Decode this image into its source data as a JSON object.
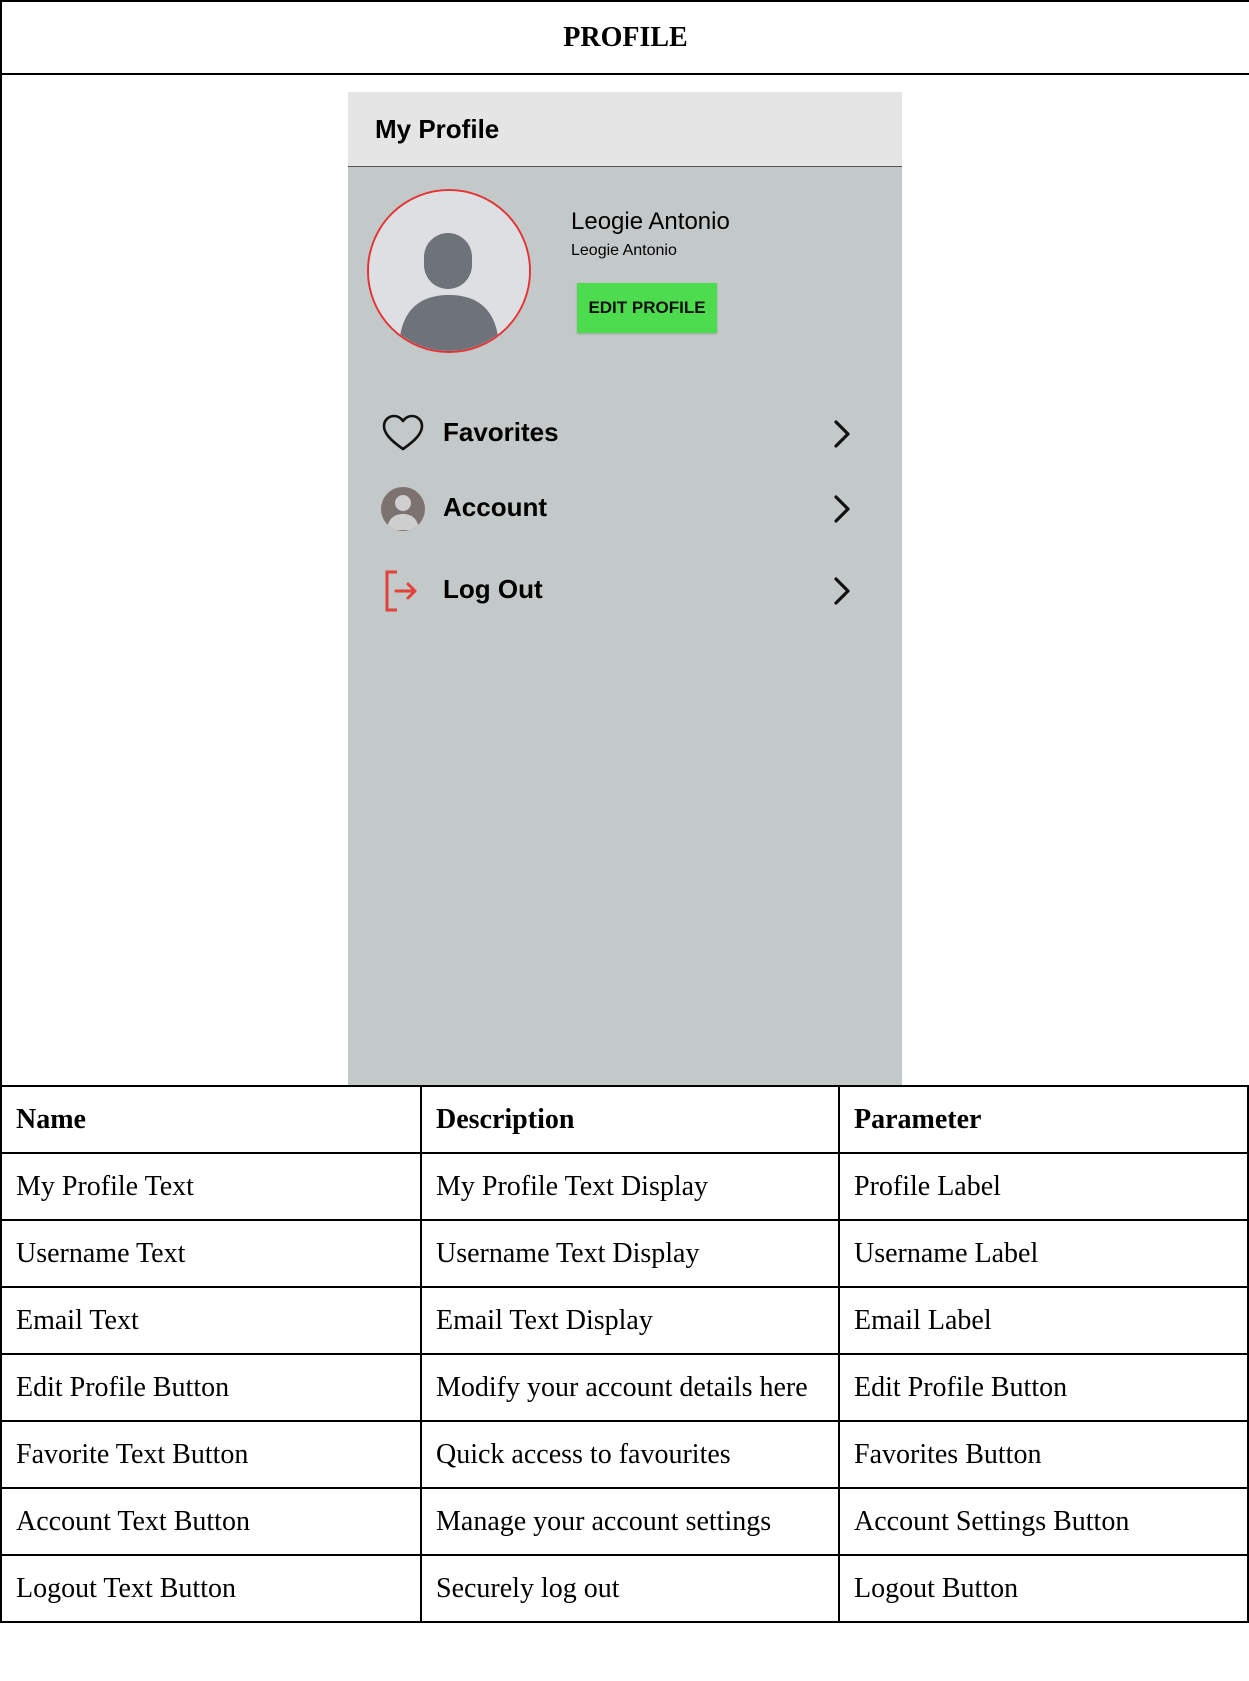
{
  "document": {
    "title": "PROFILE"
  },
  "phone": {
    "header_title": "My Profile",
    "user_name": "Leogie Antonio",
    "user_email": "Leogie Antonio",
    "edit_button_label": "EDIT PROFILE",
    "menu": [
      {
        "label": "Favorites",
        "icon": "heart-icon"
      },
      {
        "label": "Account",
        "icon": "account-circle-icon"
      },
      {
        "label": "Log Out",
        "icon": "logout-icon"
      }
    ],
    "colors": {
      "screen_bg": "#c3c8c9",
      "header_bg": "#e5e5e5",
      "edit_button": "#4ddc4d",
      "avatar_ring": "#e53333",
      "logout_icon": "#e2403a"
    }
  },
  "table": {
    "headers": [
      "Name",
      "Description",
      "Parameter"
    ],
    "rows": [
      [
        "My Profile Text",
        "My Profile Text Display",
        "Profile Label"
      ],
      [
        "Username Text",
        "Username Text Display",
        "Username Label"
      ],
      [
        "Email Text",
        "Email Text Display",
        "Email Label"
      ],
      [
        "Edit Profile Button",
        "Modify your account details here",
        "Edit Profile Button"
      ],
      [
        "Favorite Text Button",
        "Quick access to favourites",
        "Favorites Button"
      ],
      [
        "Account Text Button",
        "Manage your account settings",
        "Account Settings Button"
      ],
      [
        "Logout Text Button",
        "Securely log out",
        "Logout Button"
      ]
    ]
  }
}
